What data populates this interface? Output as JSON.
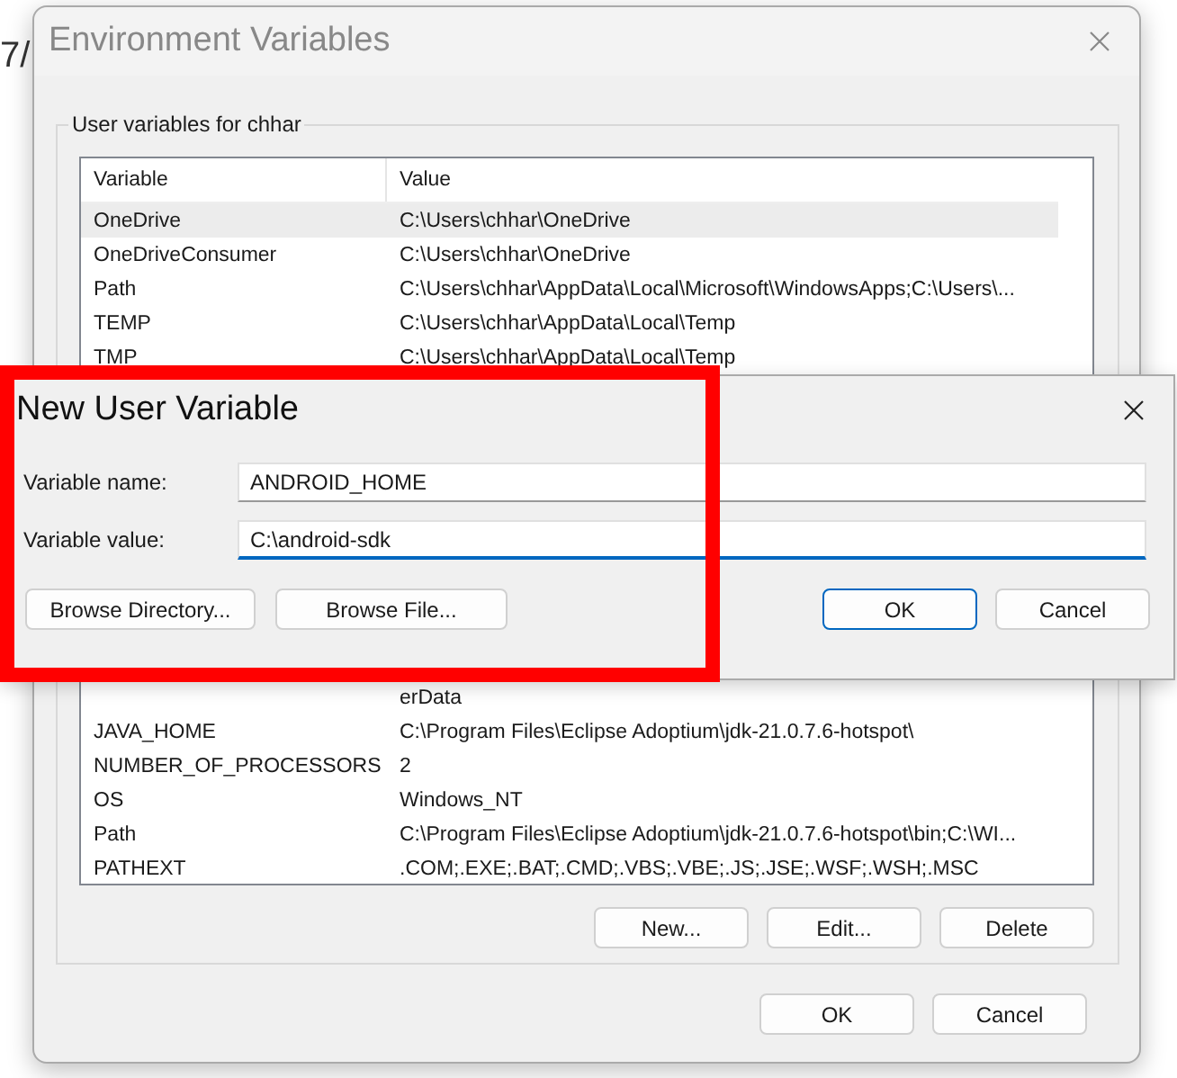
{
  "background": {
    "text": "7/"
  },
  "env_window": {
    "title": "Environment Variables",
    "group_label": "User variables for chhar",
    "columns": [
      "Variable",
      "Value"
    ],
    "user_rows": [
      {
        "variable": "OneDrive",
        "value": "C:\\Users\\chhar\\OneDrive",
        "selected": true
      },
      {
        "variable": "OneDriveConsumer",
        "value": "C:\\Users\\chhar\\OneDrive",
        "selected": false
      },
      {
        "variable": "Path",
        "value": "C:\\Users\\chhar\\AppData\\Local\\Microsoft\\WindowsApps;C:\\Users\\...",
        "selected": false
      },
      {
        "variable": "TEMP",
        "value": "C:\\Users\\chhar\\AppData\\Local\\Temp",
        "selected": false
      },
      {
        "variable": "TMP",
        "value": "C:\\Users\\chhar\\AppData\\Local\\Temp",
        "selected": false
      }
    ],
    "lower_rows": [
      {
        "variable": "",
        "value": "erData",
        "selected": false
      },
      {
        "variable": "JAVA_HOME",
        "value": "C:\\Program Files\\Eclipse Adoptium\\jdk-21.0.7.6-hotspot\\",
        "selected": false
      },
      {
        "variable": "NUMBER_OF_PROCESSORS",
        "value": "2",
        "selected": false
      },
      {
        "variable": "OS",
        "value": "Windows_NT",
        "selected": false
      },
      {
        "variable": "Path",
        "value": "C:\\Program Files\\Eclipse Adoptium\\jdk-21.0.7.6-hotspot\\bin;C:\\WI...",
        "selected": false
      },
      {
        "variable": "PATHEXT",
        "value": ".COM;.EXE;.BAT;.CMD;.VBS;.VBE;.JS;.JSE;.WSF;.WSH;.MSC",
        "selected": false
      }
    ],
    "list_buttons": [
      "New...",
      "Edit...",
      "Delete"
    ],
    "buttons": [
      "OK",
      "Cancel"
    ]
  },
  "new_variable_dialog": {
    "title": "New User Variable",
    "fields": [
      {
        "label": "Variable name:",
        "value": "ANDROID_HOME",
        "focused": false
      },
      {
        "label": "Variable value:",
        "value": "C:\\android-sdk",
        "focused": true
      }
    ],
    "browse_buttons": [
      "Browse Directory...",
      "Browse File..."
    ],
    "buttons": [
      {
        "label": "OK",
        "default": true
      },
      {
        "label": "Cancel",
        "default": false
      }
    ]
  },
  "highlight": {
    "color": "#ff0000"
  }
}
